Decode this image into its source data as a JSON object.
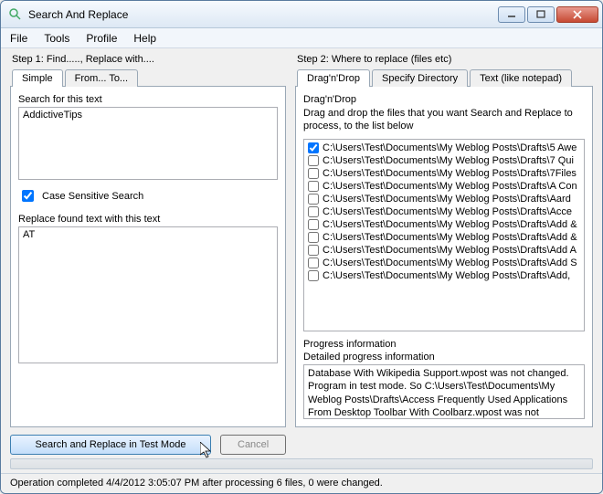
{
  "title": "Search And Replace",
  "menu": {
    "file": "File",
    "tools": "Tools",
    "profile": "Profile",
    "help": "Help"
  },
  "step1": {
    "label": "Step 1: Find....., Replace with....",
    "tabs": {
      "simple": "Simple",
      "fromto": "From... To..."
    },
    "search_label": "Search for this text",
    "search_value": "AddictiveTips",
    "case_label": "Case Sensitive Search",
    "case_checked": true,
    "replace_label": "Replace found text with this text",
    "replace_value": "AT"
  },
  "step2": {
    "label": "Step 2: Where to replace (files etc)",
    "tabs": {
      "drag": "Drag'n'Drop",
      "dir": "Specify Directory",
      "text": "Text (like notepad)"
    },
    "drag_title": "Drag'n'Drop",
    "drag_instruction": "Drag and drop the files that you want Search and Replace to process, to the list below",
    "files": [
      {
        "checked": true,
        "path": "C:\\Users\\Test\\Documents\\My Weblog Posts\\Drafts\\5 Awe"
      },
      {
        "checked": false,
        "path": "C:\\Users\\Test\\Documents\\My Weblog Posts\\Drafts\\7 Qui"
      },
      {
        "checked": false,
        "path": "C:\\Users\\Test\\Documents\\My Weblog Posts\\Drafts\\7Files"
      },
      {
        "checked": false,
        "path": "C:\\Users\\Test\\Documents\\My Weblog Posts\\Drafts\\A Con"
      },
      {
        "checked": false,
        "path": "C:\\Users\\Test\\Documents\\My Weblog Posts\\Drafts\\Aard"
      },
      {
        "checked": false,
        "path": "C:\\Users\\Test\\Documents\\My Weblog Posts\\Drafts\\Acce"
      },
      {
        "checked": false,
        "path": "C:\\Users\\Test\\Documents\\My Weblog Posts\\Drafts\\Add &"
      },
      {
        "checked": false,
        "path": "C:\\Users\\Test\\Documents\\My Weblog Posts\\Drafts\\Add &"
      },
      {
        "checked": false,
        "path": "C:\\Users\\Test\\Documents\\My Weblog Posts\\Drafts\\Add A"
      },
      {
        "checked": false,
        "path": "C:\\Users\\Test\\Documents\\My Weblog Posts\\Drafts\\Add S"
      },
      {
        "checked": false,
        "path": "C:\\Users\\Test\\Documents\\My Weblog Posts\\Drafts\\Add,"
      }
    ],
    "progress_title": "Progress information",
    "progress_detail_label": "Detailed progress information",
    "progress_text": "Database With Wikipedia Support.wpost was not changed. Program in test mode. So C:\\Users\\Test\\Documents\\My Weblog Posts\\Drafts\\Access Frequently Used Applications From Desktop Toolbar With Coolbarz.wpost was not changed."
  },
  "buttons": {
    "search": "Search and Replace in Test Mode",
    "cancel": "Cancel"
  },
  "status": "Operation completed 4/4/2012 3:05:07 PM after processing 6 files, 0 were changed."
}
